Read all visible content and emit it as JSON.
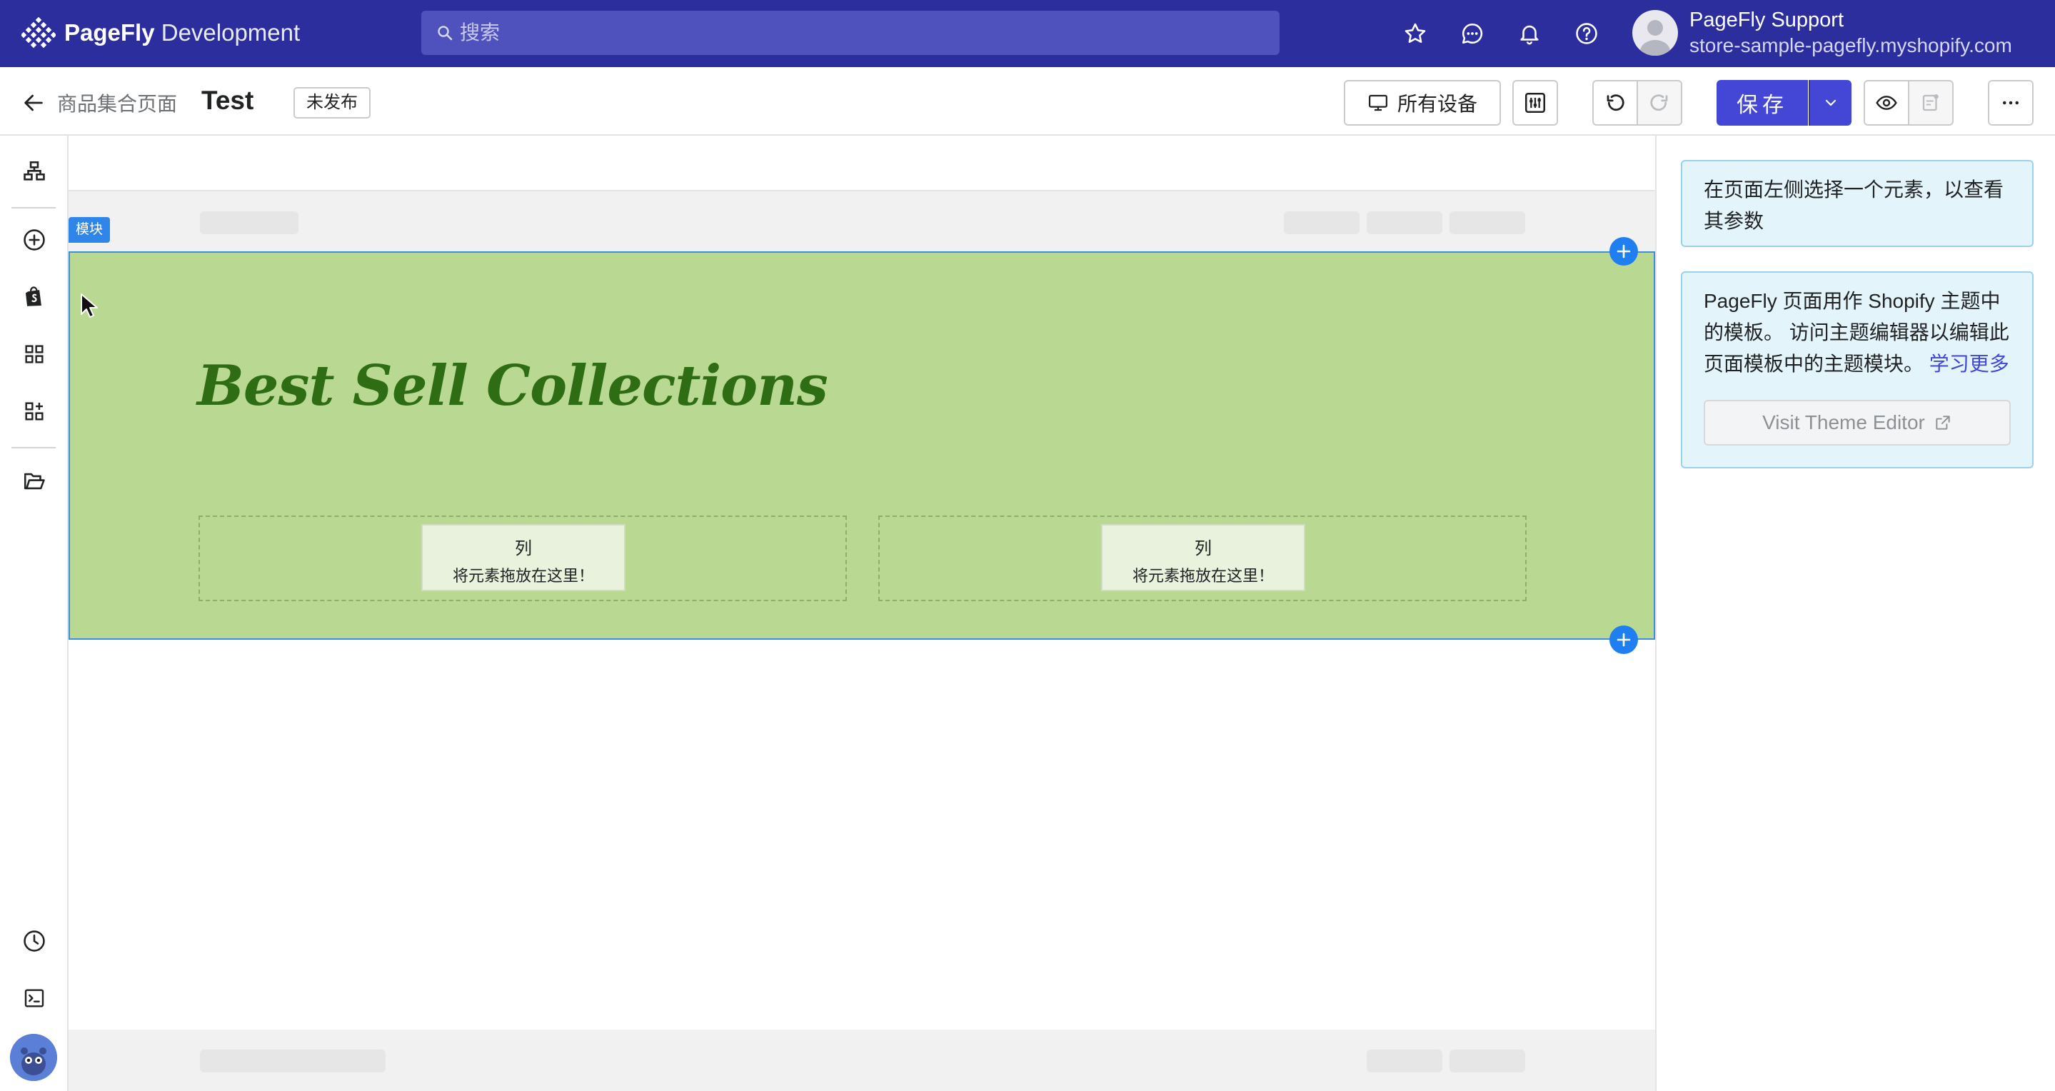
{
  "topbar": {
    "app_name_bold": "PageFly",
    "app_name_rest": " Development",
    "search_placeholder": "搜索",
    "user_name": "PageFly Support",
    "user_store": "store-sample-pagefly.myshopify.com",
    "colors": {
      "bar": "#2c2e9e",
      "search": "#4f51bd"
    }
  },
  "subbar": {
    "back_label": "商品集合页面",
    "page_title": "Test",
    "status": "未发布",
    "device_label": "所有设备",
    "save_label": "保存"
  },
  "canvas": {
    "section_tag": "模块",
    "heading": "Best Sell Collections",
    "columns": [
      {
        "title": "列",
        "hint": "将元素拖放在这里！"
      },
      {
        "title": "列",
        "hint": "将元素拖放在这里！"
      }
    ],
    "colors": {
      "section_bg": "#b9d992",
      "heading": "#2f6d14",
      "accent": "#1f7ff0"
    }
  },
  "rightpanel": {
    "select_hint": "在页面左侧选择一个元素，以查看其参数",
    "theme_info": "PageFly 页面用作 Shopify 主题中的模板。 访问主题编辑器以编辑此页面模板中的主题模块。",
    "learn_more": "学习更多",
    "theme_button": "Visit Theme Editor"
  }
}
